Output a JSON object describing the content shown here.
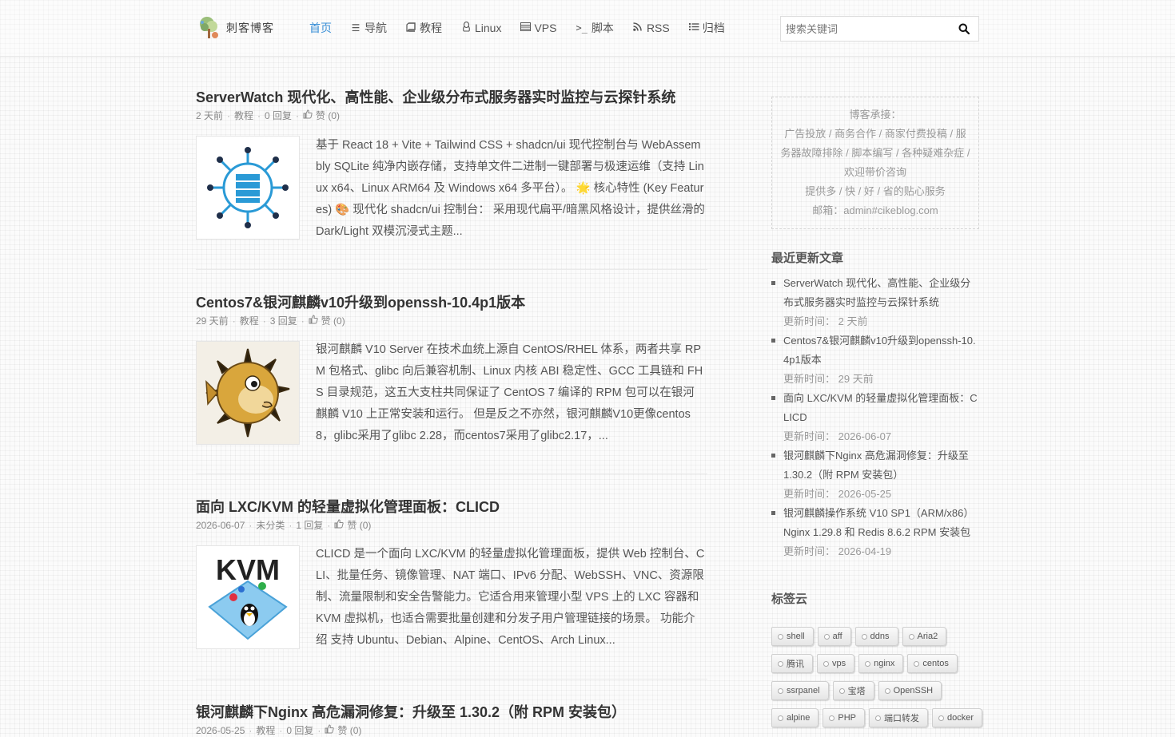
{
  "header": {
    "logo_text": "刺客博客",
    "nav": [
      {
        "label": "首页",
        "icon": "",
        "active": true
      },
      {
        "label": "导航",
        "icon": "list-icon"
      },
      {
        "label": "教程",
        "icon": "book-icon"
      },
      {
        "label": "Linux",
        "icon": "linux-icon"
      },
      {
        "label": "VPS",
        "icon": "server-icon"
      },
      {
        "label": "脚本",
        "icon": "terminal-icon"
      },
      {
        "label": "RSS",
        "icon": "rss-icon"
      },
      {
        "label": "归档",
        "icon": "archive-list-icon"
      }
    ],
    "search_placeholder": "搜索关键词"
  },
  "posts": [
    {
      "title": "ServerWatch 现代化、高性能、企业级分布式服务器实时监控与云探针系统",
      "date": "2 天前",
      "category": "教程",
      "replies": "0 回复",
      "likes": "赞 (0)",
      "excerpt": "基于 React 18 + Vite + Tailwind CSS + shadcn/ui 现代控制台与 WebAssembly SQLite 纯净内嵌存储，支持单文件二进制一键部署与极速运维（支持 Linux x64、Linux ARM64 及 Windows x64 多平台）。 🌟 核心特性 (Key Features) 🎨 现代化 shadcn/ui 控制台： 采用现代扁平/暗黑风格设计，提供丝滑的 Dark/Light 双模沉浸式主题..."
    },
    {
      "title": "Centos7&银河麒麟v10升级到openssh-10.4p1版本",
      "date": "29 天前",
      "category": "教程",
      "replies": "3 回复",
      "likes": "赞 (0)",
      "excerpt": "银河麒麟 V10 Server 在技术血统上源自 CentOS/RHEL 体系，两者共享 RPM 包格式、glibc 向后兼容机制、Linux 内核 ABI 稳定性、GCC 工具链和 FHS 目录规范，这五大支柱共同保证了 CentOS 7 编译的 RPM 包可以在银河麒麟 V10 上正常安装和运行。 但是反之不亦然，银河麒麟V10更像centos8，glibc采用了glibc 2.28，而centos7采用了glibc2.17，..."
    },
    {
      "title": "面向 LXC/KVM 的轻量虚拟化管理面板：CLICD",
      "date": "2026-06-07",
      "category": "未分类",
      "replies": "1 回复",
      "likes": "赞 (0)",
      "excerpt": "CLICD 是一个面向 LXC/KVM 的轻量虚拟化管理面板，提供 Web 控制台、CLI、批量任务、镜像管理、NAT 端口、IPv6 分配、WebSSH、VNC、资源限制、流量限制和安全告警能力。它适合用来管理小型 VPS 上的 LXC 容器和 KVM 虚拟机，也适合需要批量创建和分发子用户管理链接的场景。 功能介绍 支持 Ubuntu、Debian、Alpine、CentOS、Arch Linux..."
    },
    {
      "title": "银河麒麟下Nginx 高危漏洞修复：升级至 1.30.2（附 RPM 安装包）",
      "date": "2026-05-25",
      "category": "教程",
      "replies": "0 回复",
      "likes": "赞 (0)",
      "excerpt": ""
    }
  ],
  "sidebar": {
    "ad": {
      "line1": "博客承接：",
      "line2": "广告投放 / 商务合作 / 商家付费投稿 / 服务器故障排除 / 脚本编写 / 各种疑难杂症 / 欢迎带价咨询",
      "line3": "提供多 / 快 / 好 / 省的贴心服务",
      "line4": "邮箱：admin#cikeblog.com"
    },
    "recent_title": "最近更新文章",
    "time_label": "更新时间：",
    "recent": [
      {
        "title": "ServerWatch 现代化、高性能、企业级分布式服务器实时监控与云探针系统",
        "time": "2 天前"
      },
      {
        "title": "Centos7&银河麒麟v10升级到openssh-10.4p1版本",
        "time": "29 天前"
      },
      {
        "title": "面向 LXC/KVM 的轻量虚拟化管理面板：CLICD",
        "time": "2026-06-07"
      },
      {
        "title": "银河麒麟下Nginx 高危漏洞修复：升级至 1.30.2（附 RPM 安装包）",
        "time": "2026-05-25"
      },
      {
        "title": "银河麒麟操作系统 V10 SP1（ARM/x86）Nginx 1.29.8 和 Redis 8.6.2 RPM 安装包",
        "time": "2026-04-19"
      }
    ],
    "tags_title": "标签云",
    "tags": [
      [
        "shell",
        "aff",
        "ddns",
        "Aria2"
      ],
      [
        "腾讯",
        "vps",
        "nginx",
        "centos"
      ],
      [
        "ssrpanel",
        "宝塔",
        "OpenSSH"
      ],
      [
        "alpine",
        "PHP",
        "端口转发",
        "docker"
      ]
    ]
  }
}
